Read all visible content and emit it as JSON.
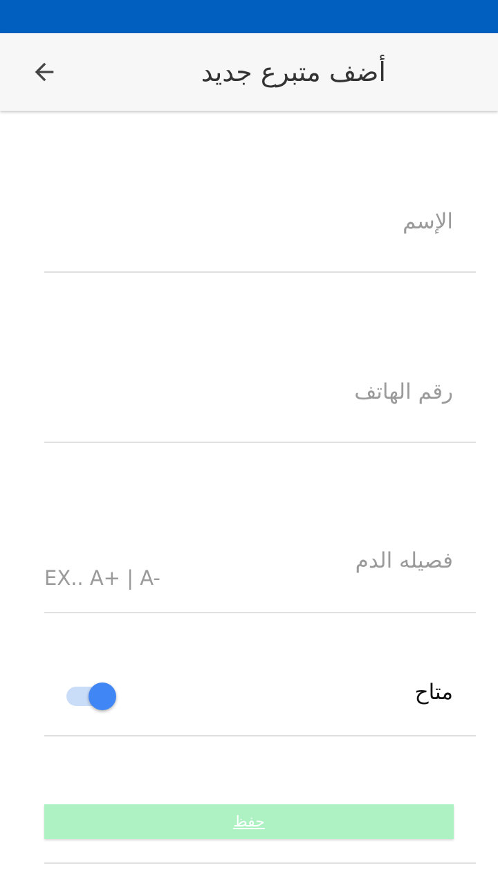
{
  "app_bar": {
    "title": "أضف متبرع جديد",
    "back_icon": "arrow-back-icon"
  },
  "form": {
    "name_label": "الإسم",
    "name_value": "",
    "phone_label": "رقم الهاتف",
    "phone_value": "",
    "blood_type_label": "فصيله الدم",
    "blood_type_hint": "EX..  A+  |  A-",
    "blood_type_value": "",
    "available_label": "متاح",
    "available_on": true
  },
  "actions": {
    "save_label": "حفظ"
  },
  "colors": {
    "status_bar": "#005fbf",
    "app_bar": "#f7f7f7",
    "switch_thumb": "#4186f5",
    "switch_track": "#c9dcf8",
    "save_button": "#aef2c4"
  }
}
